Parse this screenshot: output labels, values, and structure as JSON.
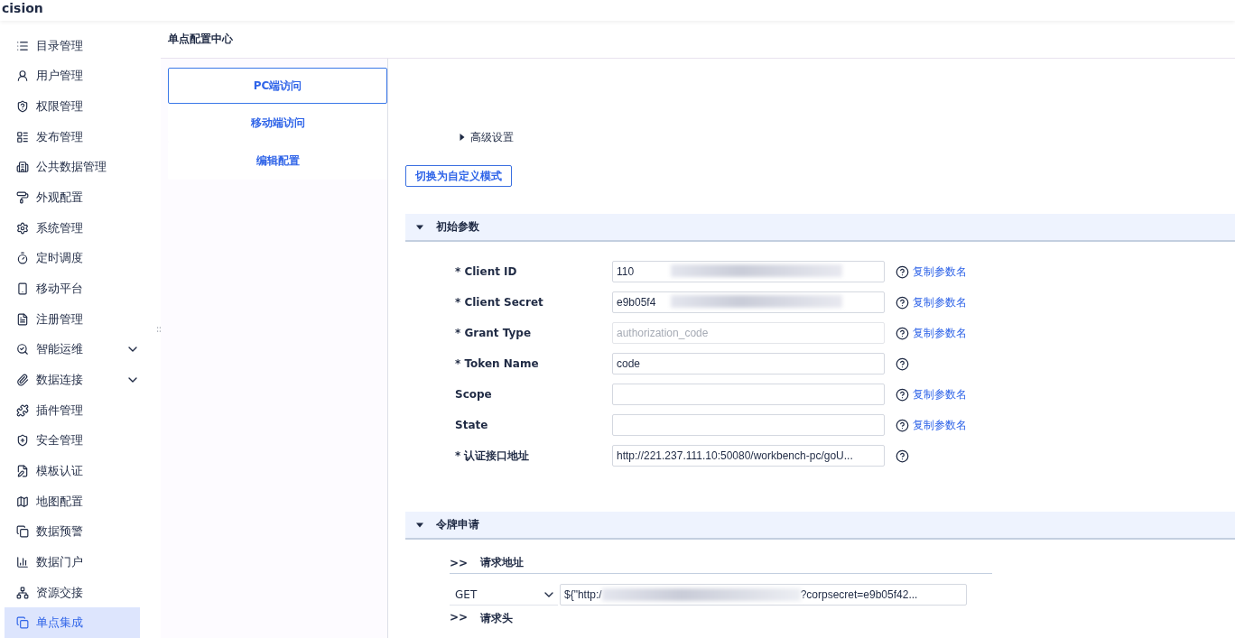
{
  "header": {
    "logo_text": "cision"
  },
  "sidebar": {
    "items": [
      {
        "label": "目录管理",
        "kind": "link",
        "selected": false
      },
      {
        "label": "用户管理",
        "kind": "link",
        "selected": false
      },
      {
        "label": "权限管理",
        "kind": "link",
        "selected": false
      },
      {
        "label": "发布管理",
        "kind": "link",
        "selected": false
      },
      {
        "label": "公共数据管理",
        "kind": "link",
        "selected": false
      },
      {
        "label": "外观配置",
        "kind": "link",
        "selected": false
      },
      {
        "label": "系统管理",
        "kind": "link",
        "selected": false
      },
      {
        "label": "定时调度",
        "kind": "link",
        "selected": false
      },
      {
        "label": "移动平台",
        "kind": "link",
        "selected": false
      },
      {
        "label": "注册管理",
        "kind": "link",
        "selected": false
      },
      {
        "label": "智能运维",
        "kind": "group",
        "selected": false,
        "expanded": false
      },
      {
        "label": "数据连接",
        "kind": "group",
        "selected": false,
        "expanded": false
      },
      {
        "label": "插件管理",
        "kind": "link",
        "selected": false
      },
      {
        "label": "安全管理",
        "kind": "link",
        "selected": false
      },
      {
        "label": "模板认证",
        "kind": "link",
        "selected": false
      },
      {
        "label": "地图配置",
        "kind": "link",
        "selected": false
      },
      {
        "label": "数据预警",
        "kind": "link",
        "selected": false
      },
      {
        "label": "数据门户",
        "kind": "link",
        "selected": false
      },
      {
        "label": "资源交接",
        "kind": "link",
        "selected": false
      },
      {
        "label": "单点集成",
        "kind": "link",
        "selected": true
      }
    ]
  },
  "page_title": "单点配置中心",
  "tabs": [
    {
      "label": "PC端访问",
      "selected": true
    },
    {
      "label": "移动端访问",
      "selected": false
    },
    {
      "label": "编辑配置",
      "selected": false
    }
  ],
  "advanced": {
    "label": "高级设置",
    "expanded": false
  },
  "switch_button": "切换为自定义模式",
  "sections": [
    {
      "title": "初始参数",
      "expanded": true,
      "fields": [
        {
          "label": "* Client ID",
          "value": "110",
          "blurred": true,
          "disabled": false,
          "copy_link": "复制参数名"
        },
        {
          "label": "* Client Secret",
          "value": "e9b05f4",
          "blurred": true,
          "disabled": false,
          "copy_link": "复制参数名"
        },
        {
          "label": "* Grant Type",
          "placeholder": "authorization_code",
          "blurred": false,
          "disabled": true,
          "copy_link": "复制参数名"
        },
        {
          "label": "* Token Name",
          "value": "code",
          "blurred": false,
          "disabled": false
        },
        {
          "label": "Scope",
          "blurred": false,
          "disabled": false,
          "copy_link": "复制参数名"
        },
        {
          "label": "State",
          "blurred": false,
          "disabled": false,
          "copy_link": "复制参数名"
        },
        {
          "label": "* 认证接口地址",
          "value": "http://221.237.111.10:50080/workbench-pc/goU...",
          "blurred": false,
          "disabled": false
        }
      ]
    },
    {
      "title": "令牌申请",
      "expanded": true,
      "request": {
        "marker": ">>",
        "title": "请求地址",
        "method": "GET",
        "url_prefix": "${\"http:/",
        "url_suffix": "?corpsecret=e9b05f42..."
      },
      "next": {
        "marker": ">>",
        "title": "请求头"
      }
    }
  ]
}
